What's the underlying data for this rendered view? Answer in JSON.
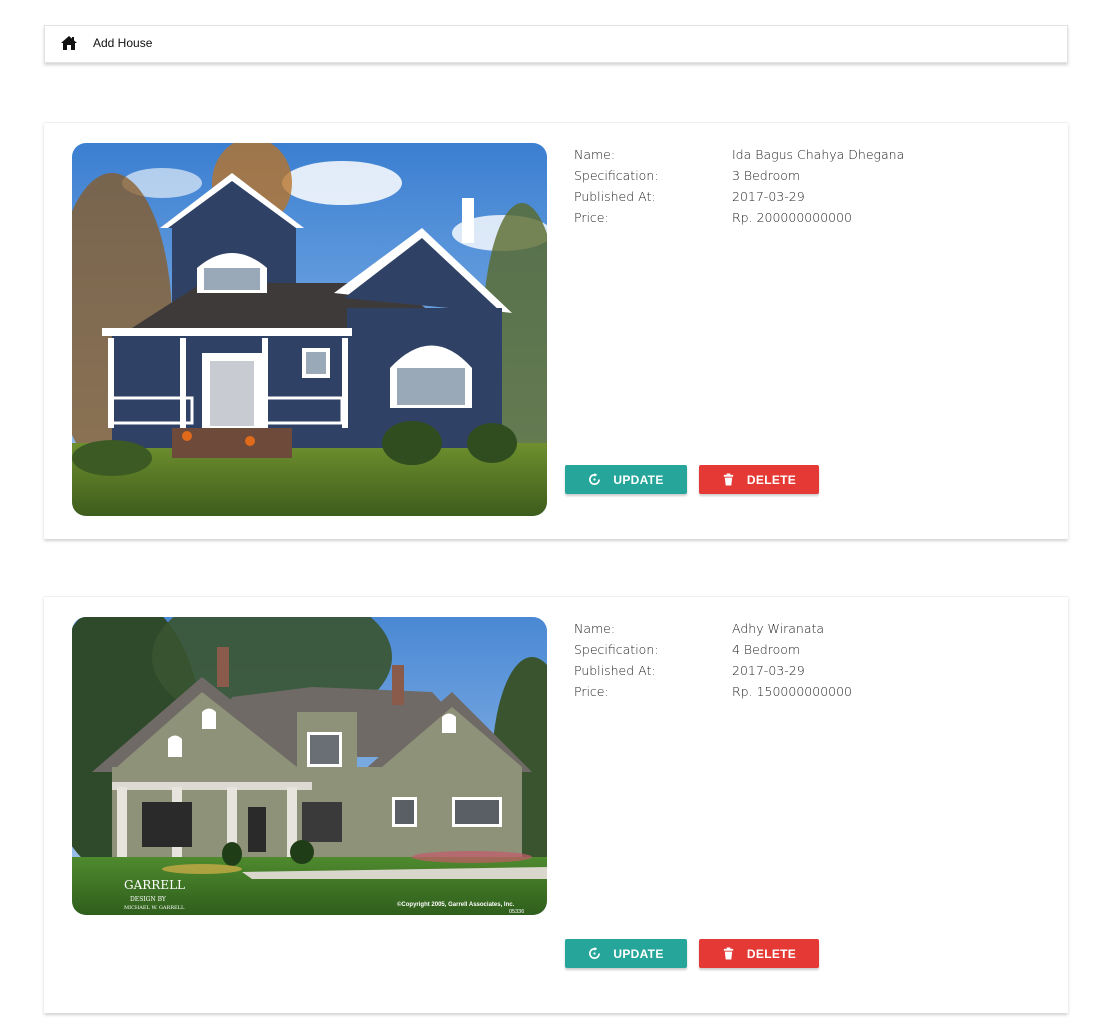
{
  "navbar": {
    "home_icon": "home-icon",
    "add_label": "Add House"
  },
  "houses": [
    {
      "photo": "house-photo-blue-cottage",
      "name_label": "Name:",
      "name": "Ida Bagus Chahya Dhegana",
      "spec_label": "Specification:",
      "specification": "3 Bedroom",
      "published_label": "Published At:",
      "published_at": "2017-03-29",
      "price_label": "Price:",
      "price": "Rp. 200000000000",
      "update_label": "UPDATE",
      "delete_label": "DELETE"
    },
    {
      "photo": "house-photo-green-craftsman",
      "photo_caption_left": "GARRELL",
      "photo_caption_design": "DESIGN BY",
      "photo_caption_name": "MICHAEL W. GARRELL",
      "photo_caption_copyright": "©Copyright 2005, Garrell Associates, Inc.",
      "photo_caption_code": "05336",
      "name_label": "Name:",
      "name": "Adhy Wiranata",
      "spec_label": "Specification:",
      "specification": "4 Bedroom",
      "published_label": "Published At:",
      "published_at": "2017-03-29",
      "price_label": "Price:",
      "price": "Rp. 150000000000",
      "update_label": "UPDATE",
      "delete_label": "DELETE"
    }
  ],
  "colors": {
    "update": "#26a69a",
    "delete": "#e53935"
  }
}
